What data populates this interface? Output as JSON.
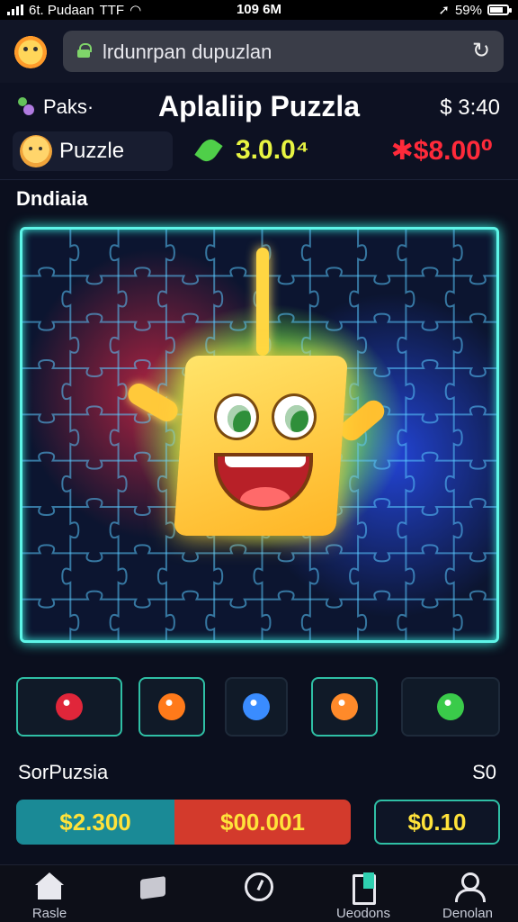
{
  "status_bar": {
    "carrier": "6t. Pudaan",
    "network": "TTF",
    "time": "109 6M",
    "battery": "59%"
  },
  "browser": {
    "url": "lrdunrpan dupuzlan"
  },
  "header": {
    "left_label": "Paks·",
    "title": "Aplaliip Puzzla",
    "balance": "$ 3:40",
    "tab_label": "Puzzle",
    "points": "3.0.0⁴",
    "red_amount": "✱$8.00⁰"
  },
  "board": {
    "label": "Dndiaia",
    "rows": 9,
    "cols": 10
  },
  "powerups": [
    {
      "name": "bomb-icon",
      "color": "#e0263a"
    },
    {
      "name": "balloon-icon",
      "color": "#ff7a1a"
    },
    {
      "name": "magnifier-icon",
      "color": "#3a8cff"
    },
    {
      "name": "crab-icon",
      "color": "#ff8a2a"
    },
    {
      "name": "gem-icon",
      "color": "#3acb4a"
    }
  ],
  "score": {
    "label": "SorPuzsia",
    "value": "S0"
  },
  "bets": {
    "a": "$2.300",
    "b": "$00.001",
    "c": "$0.10"
  },
  "nav": [
    {
      "label": "Rasle",
      "icon": "home-icon"
    },
    {
      "label": "",
      "icon": "box-icon"
    },
    {
      "label": "",
      "icon": "clock-icon"
    },
    {
      "label": "Ueodons",
      "icon": "document-icon"
    },
    {
      "label": "Denolan",
      "icon": "person-icon"
    }
  ],
  "colors": {
    "accent": "#5ef5e8",
    "points": "#e8f542",
    "danger": "#ff2a3a",
    "bet_gold": "#ffe23a"
  }
}
